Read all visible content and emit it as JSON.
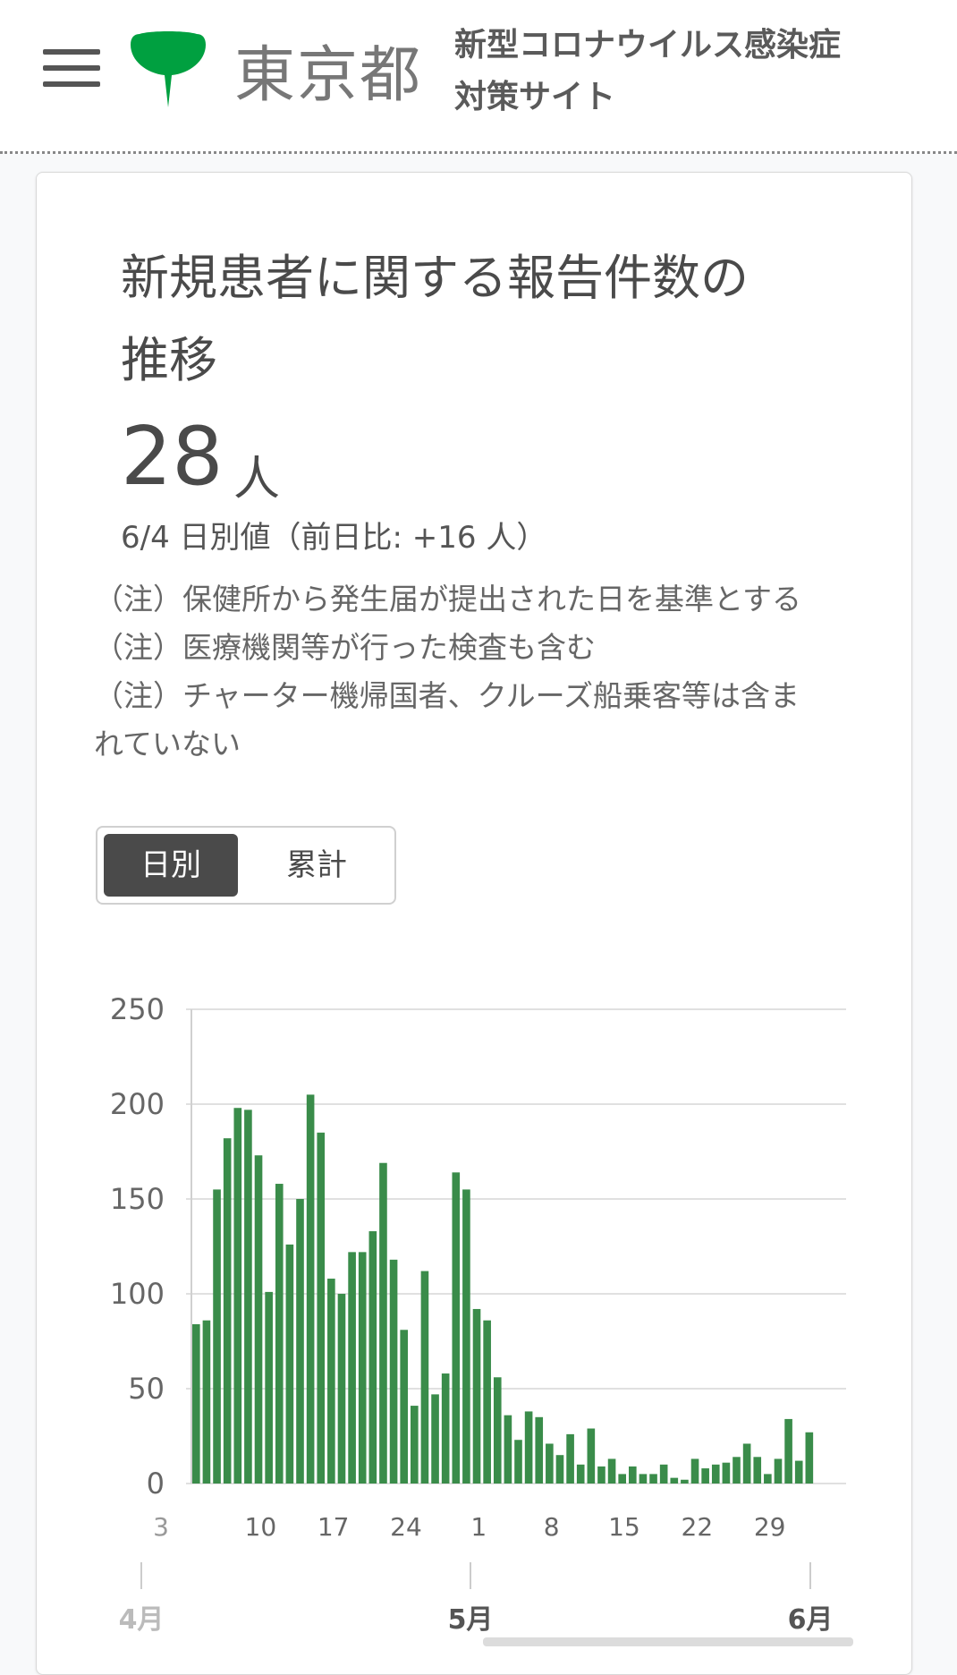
{
  "header": {
    "logo_text": "東京都",
    "site_title_line1": "新型コロナウイルス感染症",
    "site_title_line2": "対策サイト"
  },
  "colors": {
    "accent": "#00a040",
    "bar": "#3a8c4a",
    "text": "#4a4a4a"
  },
  "card": {
    "title_line1": "新規患者に関する報告件数の",
    "title_line2": "推移",
    "value": "28",
    "unit": "人",
    "sub_value": "6/4 日別値（前日比: +16 人）",
    "notes": [
      "（注）保健所から発生届が提出された日を基準とする",
      "（注）医療機関等が行った検査も含む",
      "（注）チャーター機帰国者、クルーズ船乗客等は含ま",
      "れていない"
    ],
    "toggle": {
      "daily": "日別",
      "cumulative": "累計"
    }
  },
  "chart_data": {
    "type": "bar",
    "ylim": [
      0,
      250
    ],
    "y_ticks": [
      "0",
      "50",
      "100",
      "150",
      "200",
      "250"
    ],
    "x_day_labels": [
      "3",
      "10",
      "17",
      "24",
      "1",
      "8",
      "15",
      "22",
      "29"
    ],
    "x_month_labels": [
      "4月",
      "5月",
      "6月"
    ],
    "categories": [
      "4/3",
      "4/4",
      "4/5",
      "4/6",
      "4/7",
      "4/8",
      "4/9",
      "4/10",
      "4/11",
      "4/12",
      "4/13",
      "4/14",
      "4/15",
      "4/16",
      "4/17",
      "4/18",
      "4/19",
      "4/20",
      "4/21",
      "4/22",
      "4/23",
      "4/24",
      "4/25",
      "4/26",
      "4/27",
      "4/28",
      "4/29",
      "4/30",
      "5/1",
      "5/2",
      "5/3",
      "5/4",
      "5/5",
      "5/6",
      "5/7",
      "5/8",
      "5/9",
      "5/10",
      "5/11",
      "5/12",
      "5/13",
      "5/14",
      "5/15",
      "5/16",
      "5/17",
      "5/18",
      "5/19",
      "5/20",
      "5/21",
      "5/22",
      "5/23",
      "5/24",
      "5/25",
      "5/26",
      "5/27",
      "5/28",
      "5/29",
      "5/30",
      "5/31",
      "6/1",
      "6/2",
      "6/3",
      "6/4"
    ],
    "values": [
      84,
      86,
      155,
      182,
      198,
      197,
      173,
      101,
      158,
      126,
      150,
      205,
      185,
      108,
      100,
      122,
      122,
      133,
      169,
      118,
      81,
      41,
      112,
      47,
      58,
      164,
      155,
      92,
      86,
      56,
      36,
      23,
      38,
      35,
      21,
      15,
      26,
      10,
      29,
      9,
      13,
      5,
      9,
      5,
      5,
      10,
      3,
      2,
      13,
      8,
      10,
      11,
      14,
      21,
      14,
      5,
      13,
      34,
      12,
      27,
      0,
      0,
      0
    ]
  }
}
